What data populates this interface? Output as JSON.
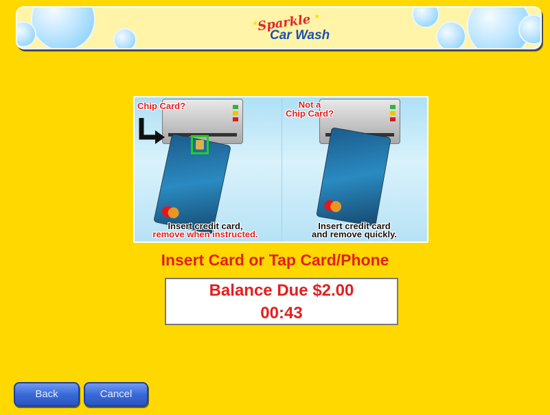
{
  "header": {
    "logo_script": "Sparkle",
    "logo_text": "Car Wash"
  },
  "instructions": {
    "left": {
      "label": "Chip Card?",
      "caption_line1": "Insert credit card,",
      "caption_line2": "remove when instructed."
    },
    "right": {
      "label_line1": "Not a",
      "label_line2": "Chip Card?",
      "caption_line1": "Insert credit card",
      "caption_line2": "and remove quickly."
    }
  },
  "prompt": "Insert Card or Tap Card/Phone",
  "balance": {
    "line1": "Balance Due $2.00",
    "timer": "00:43"
  },
  "buttons": {
    "back": "Back",
    "cancel": "Cancel"
  },
  "colors": {
    "background": "#ffd800",
    "accent_red": "#e31e1e",
    "button_blue": "#3a6ad8"
  }
}
